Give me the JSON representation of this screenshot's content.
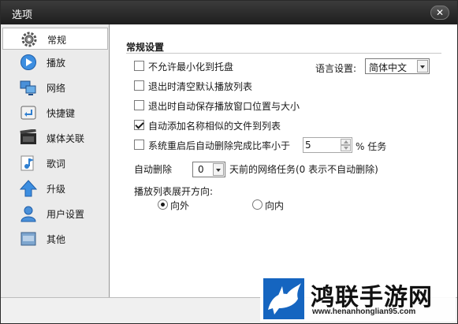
{
  "window": {
    "title": "选项",
    "close_glyph": "✕"
  },
  "sidebar": {
    "items": [
      {
        "label": "常规",
        "icon": "gear-icon",
        "selected": true
      },
      {
        "label": "播放",
        "icon": "play-icon"
      },
      {
        "label": "网络",
        "icon": "network-icon"
      },
      {
        "label": "快捷键",
        "icon": "shortcut-key-icon"
      },
      {
        "label": "媒体关联",
        "icon": "media-film-icon"
      },
      {
        "label": "歌词",
        "icon": "lyrics-note-icon"
      },
      {
        "label": "升级",
        "icon": "upgrade-arrow-icon"
      },
      {
        "label": "用户设置",
        "icon": "user-icon"
      },
      {
        "label": "其他",
        "icon": "other-misc-icon"
      }
    ]
  },
  "general": {
    "section_title": "常规设置",
    "opt_no_minimize_tray": {
      "label": "不允许最小化到托盘",
      "checked": false
    },
    "opt_clear_playlist": {
      "label": "退出时清空默认播放列表",
      "checked": false
    },
    "opt_save_window": {
      "label": "退出时自动保存播放窗口位置与大小",
      "checked": false
    },
    "opt_auto_add_similar": {
      "label": "自动添加名称相似的文件到列表",
      "checked": true
    },
    "opt_auto_delete_ratio": {
      "label": "系统重启后自动删除完成比率小于",
      "checked": false,
      "value": "5",
      "suffix": "% 任务"
    },
    "language": {
      "label": "语言设置:",
      "value": "简体中文"
    },
    "auto_delete": {
      "label": "自动删除",
      "value": "0",
      "suffix": "天前的网络任务(0 表示不自动删除)"
    },
    "playlist_direction": {
      "label": "播放列表展开方向:",
      "options": [
        {
          "label": "向外",
          "checked": true
        },
        {
          "label": "向内",
          "checked": false
        }
      ]
    }
  },
  "watermark": {
    "title": "鸿联手游网",
    "url": "www.henanhonglian95.com"
  },
  "colors": {
    "titlebar": "#2b2b2b",
    "sidebar_bg": "#ebebeb",
    "content_bg": "#ffffff",
    "icon_blue": "#2f7fd0"
  }
}
